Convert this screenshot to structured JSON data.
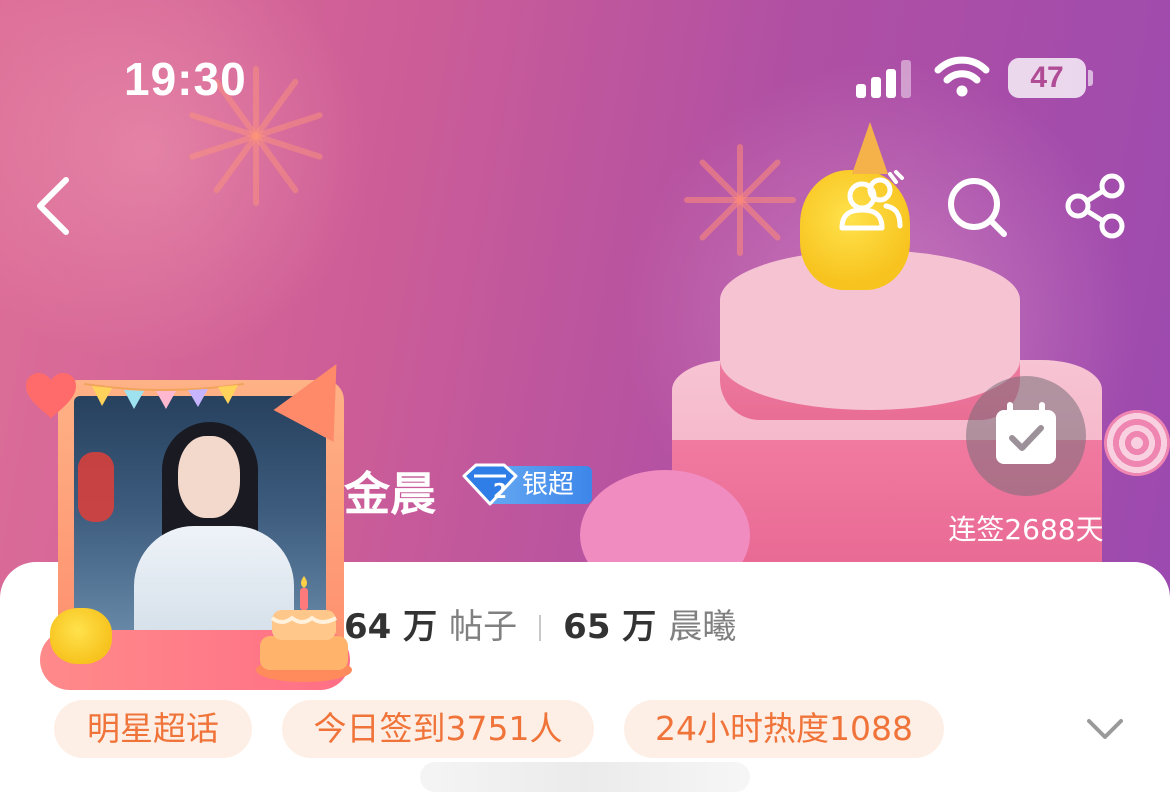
{
  "status_bar": {
    "time": "19:30",
    "battery_level": "47",
    "signal_bars_active": 3,
    "signal_bars_total": 4
  },
  "nav": {
    "back_icon": "chevron-left-icon",
    "follow_icon": "follow-users-icon",
    "search_icon": "search-icon",
    "share_icon": "share-icon"
  },
  "profile": {
    "name": "金晨",
    "level_badge_number": "2",
    "level_badge_text": "银超",
    "posts_count": "64 万",
    "posts_label": "帖子",
    "fans_count": "65 万",
    "fans_label": "晨曦"
  },
  "checkin": {
    "icon": "calendar-check-icon",
    "streak_text": "连签2688天"
  },
  "tags": [
    {
      "label": "明星超话"
    },
    {
      "label": "今日签到3751人"
    },
    {
      "label": "24小时热度1088"
    }
  ],
  "colors": {
    "banner_start": "#dd6f98",
    "banner_end": "#9c4ab0",
    "tag_bg": "#fdefe6",
    "tag_text": "#f0743a",
    "badge_blue": "#3d86ea"
  }
}
